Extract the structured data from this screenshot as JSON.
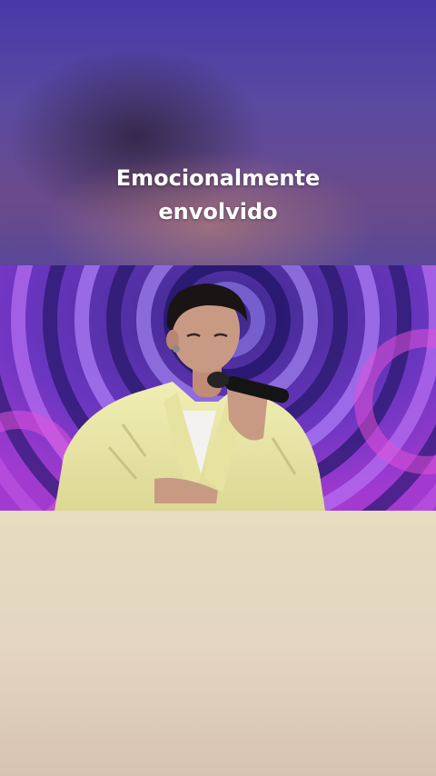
{
  "caption": {
    "line1": "Emocionalmente",
    "line2": "envolvido"
  },
  "photo": {
    "subject": "singer-with-microphone",
    "colors": {
      "ring_dark": "#2a1a6e",
      "ring_light": "#b46ef0",
      "ring_magenta": "#d04ad8",
      "jacket": "#eceaa8",
      "skin": "#c89a84",
      "hair": "#1a1414"
    }
  }
}
